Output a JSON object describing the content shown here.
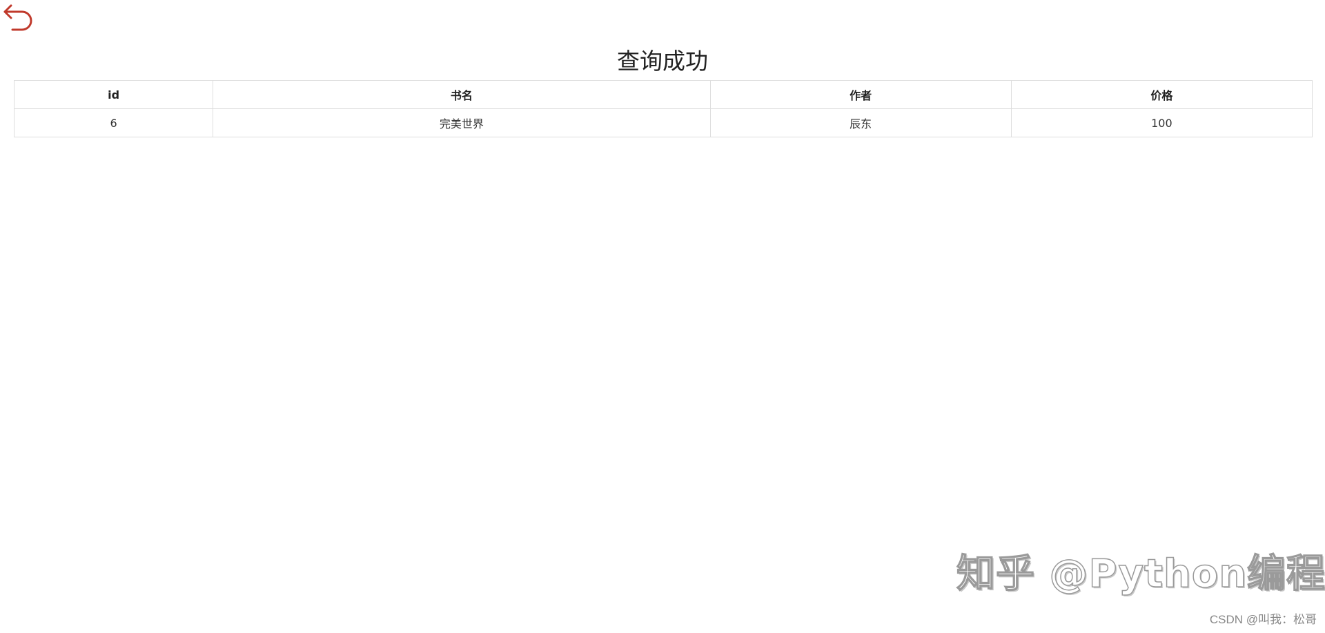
{
  "back": {
    "icon": "back-arrow-icon",
    "color": "#c0392b"
  },
  "page": {
    "title": "查询成功"
  },
  "table": {
    "headers": [
      "id",
      "书名",
      "作者",
      "价格"
    ],
    "rows": [
      [
        "6",
        "完美世界",
        "辰东",
        "100"
      ]
    ]
  },
  "watermark": {
    "text": "知乎 @Python编程"
  },
  "credit": {
    "text": "CSDN @叫我：松哥"
  }
}
